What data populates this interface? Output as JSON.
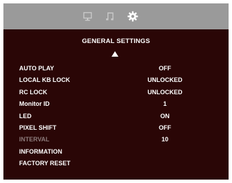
{
  "tabs": [
    {
      "icon": "monitor-icon",
      "active": false
    },
    {
      "icon": "music-note-icon",
      "active": false
    },
    {
      "icon": "gear-icon",
      "active": true
    }
  ],
  "colors": {
    "background": "#2a0606",
    "tab_bar": "#9a9a9a",
    "text": "#ffffff",
    "disabled_text": "#8c7a7a"
  },
  "menu": {
    "title": "GENERAL  SETTINGS",
    "scroll_up_icon": "triangle-up-icon",
    "items": [
      {
        "label": "AUTO PLAY",
        "value": "OFF"
      },
      {
        "label": "LOCAL KB LOCK",
        "value": "UNLOCKED"
      },
      {
        "label": "RC LOCK",
        "value": "UNLOCKED"
      },
      {
        "label": "Monitor ID",
        "value": "1"
      },
      {
        "label": "LED",
        "value": "ON"
      },
      {
        "label": "PIXEL SHIFT",
        "value": "OFF"
      },
      {
        "label": "INTERVAL",
        "value": "10",
        "disabled": true
      },
      {
        "label": "INFORMATION",
        "value": ""
      },
      {
        "label": "FACTORY RESET",
        "value": ""
      }
    ]
  }
}
